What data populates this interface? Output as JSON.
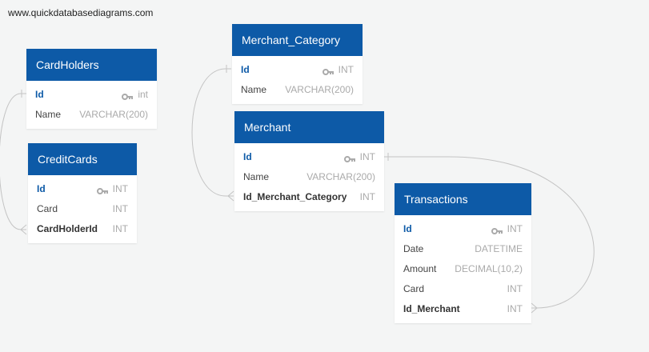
{
  "watermark": "www.quickdatabasediagrams.com",
  "tables": {
    "cardholders": {
      "title": "CardHolders",
      "fields": [
        {
          "name": "Id",
          "type": "int",
          "pk": true
        },
        {
          "name": "Name",
          "type": "VARCHAR(200)"
        }
      ]
    },
    "creditcards": {
      "title": "CreditCards",
      "fields": [
        {
          "name": "Id",
          "type": "INT",
          "pk": true
        },
        {
          "name": "Card",
          "type": "INT"
        },
        {
          "name": "CardHolderId",
          "type": "INT",
          "fk": true
        }
      ]
    },
    "merchant_category": {
      "title": "Merchant_Category",
      "fields": [
        {
          "name": "Id",
          "type": "INT",
          "pk": true
        },
        {
          "name": "Name",
          "type": "VARCHAR(200)"
        }
      ]
    },
    "merchant": {
      "title": "Merchant",
      "fields": [
        {
          "name": "Id",
          "type": "INT",
          "pk": true
        },
        {
          "name": "Name",
          "type": "VARCHAR(200)"
        },
        {
          "name": "Id_Merchant_Category",
          "type": "INT",
          "fk": true
        }
      ]
    },
    "transactions": {
      "title": "Transactions",
      "fields": [
        {
          "name": "Id",
          "type": "INT",
          "pk": true
        },
        {
          "name": "Date",
          "type": "DATETIME"
        },
        {
          "name": "Amount",
          "type": "DECIMAL(10,2)"
        },
        {
          "name": "Card",
          "type": "INT"
        },
        {
          "name": "Id_Merchant",
          "type": "INT",
          "fk": true
        }
      ]
    }
  },
  "relationships": [
    {
      "from": "CreditCards.CardHolderId",
      "to": "CardHolders.Id"
    },
    {
      "from": "Merchant.Id_Merchant_Category",
      "to": "Merchant_Category.Id"
    },
    {
      "from": "Transactions.Id_Merchant",
      "to": "Merchant.Id"
    }
  ],
  "colors": {
    "header": "#0d5aa7",
    "background": "#f4f5f5",
    "type_text": "#aaaaaa",
    "connector": "#c4c4c4"
  }
}
